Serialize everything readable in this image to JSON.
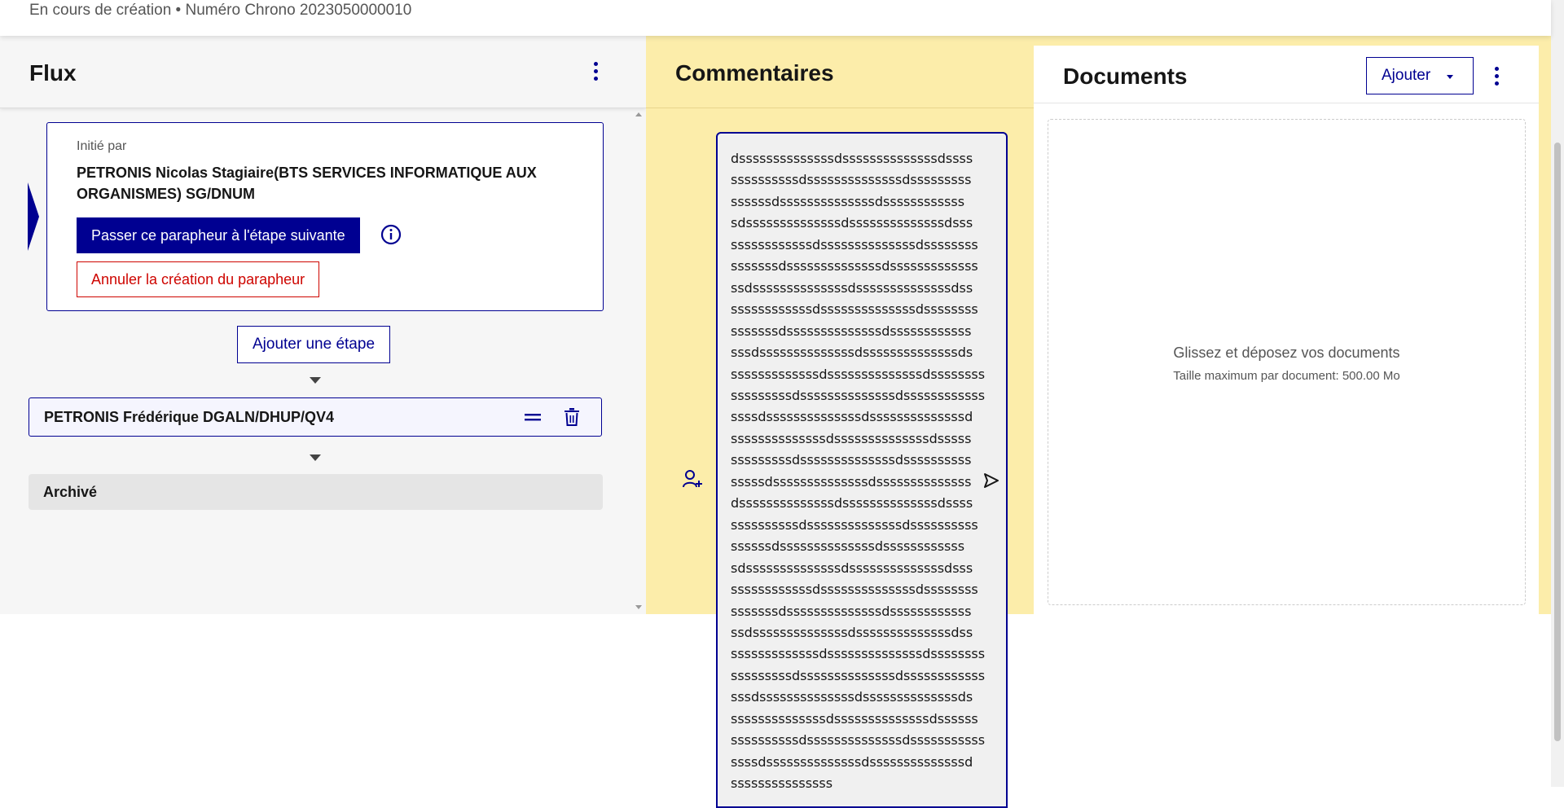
{
  "header": {
    "status": "En cours de création • Numéro Chrono 2023050000010"
  },
  "flux": {
    "title": "Flux",
    "initiator": {
      "label": "Initié par",
      "name": "PETRONIS Nicolas Stagiaire(BTS SERVICES INFORMATIQUE AUX ORGANISMES) SG/DNUM"
    },
    "next_step_button": "Passer ce parapheur à l'étape suivante",
    "cancel_button": "Annuler la création du parapheur",
    "add_step_button": "Ajouter une étape",
    "steps": [
      {
        "name": "PETRONIS Frédérique DGALN/DHUP/QV4"
      }
    ],
    "archive_label": "Archivé"
  },
  "comments": {
    "title": "Commentaires",
    "draft_lines": [
      "dssssssssssssssdssssssssssssssdssss",
      "ssssssssssdssssssssssssssdsssssssss",
      "ssssssdssssssssssssssdssssssssssss",
      "sdssssssssssssssdssssssssssssssdsss",
      "ssssssssssssdssssssssssssssdssssssss",
      "sssssssdssssssssssssssdsssssssssssss",
      "ssdssssssssssssssdssssssssssssssdss",
      "ssssssssssssdssssssssssssssdssssssss",
      "sssssssdssssssssssssssdssssssssssss",
      "sssdssssssssssssssdssssssssssssssds",
      "sssssssssssssdssssssssssssssdssssssss",
      "sssssssssdssssssssssssssdssssssssssss",
      "ssssdssssssssssssssdssssssssssssssd",
      "ssssssssssssssdssssssssssssssdsssss",
      "sssssssssdssssssssssssssdssssssssss",
      "sssssdssssssssssssssdssssssssssssss",
      "dssssssssssssssdssssssssssssssdssss",
      "ssssssssssdssssssssssssssdssssssssss",
      "ssssssdssssssssssssssdssssssssssss",
      "sdssssssssssssssdssssssssssssssdsss",
      "ssssssssssssdssssssssssssssdssssssss",
      "sssssssdssssssssssssssdssssssssssss",
      "ssdssssssssssssssdssssssssssssssdss",
      "sssssssssssssdssssssssssssssdssssssss",
      "sssssssssdssssssssssssssdssssssssssss",
      "sssdssssssssssssssdssssssssssssssds",
      "ssssssssssssssdssssssssssssssdssssss",
      "ssssssssssdssssssssssssssdsssssssssss",
      "ssssdssssssssssssssdssssssssssssssd",
      "sssssssssssssss"
    ]
  },
  "documents": {
    "title": "Documents",
    "add_button": "Ajouter",
    "drop_text": "Glissez et déposez vos documents",
    "drop_limit": "Taille maximum par document: 500.00 Mo"
  },
  "colors": {
    "primary": "#000091",
    "danger": "#ce0500",
    "comments_bg": "#fcedaa",
    "flux_bg": "#f6f6f6"
  }
}
